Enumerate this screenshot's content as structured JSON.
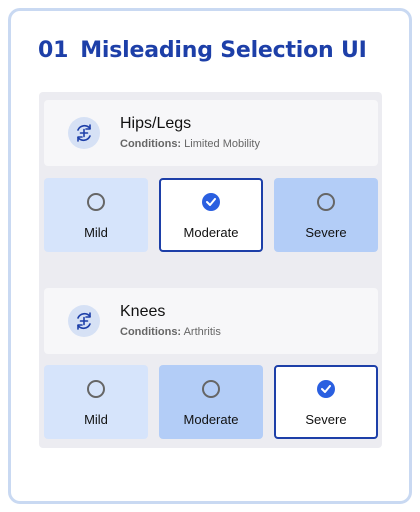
{
  "title": {
    "number": "01",
    "text": "Misleading Selection UI"
  },
  "groups": [
    {
      "name": "Hips/Legs",
      "conditions_label": "Conditions:",
      "conditions_value": "Limited Mobility",
      "icon": "rotate-plus-icon",
      "options": [
        {
          "label": "Mild",
          "selected": false
        },
        {
          "label": "Moderate",
          "selected": true
        },
        {
          "label": "Severe",
          "selected": false
        }
      ]
    },
    {
      "name": "Knees",
      "conditions_label": "Conditions:",
      "conditions_value": "Arthritis",
      "icon": "rotate-plus-icon",
      "options": [
        {
          "label": "Mild",
          "selected": false
        },
        {
          "label": "Moderate",
          "selected": false
        },
        {
          "label": "Severe",
          "selected": true
        }
      ]
    }
  ],
  "colors": {
    "accent": "#1d3fa8",
    "check": "#2a5fe0",
    "option_light": "#d6e4fb",
    "option_dark": "#b3cdf7",
    "panel": "#ececf1",
    "frame": "#c9d9f2"
  }
}
